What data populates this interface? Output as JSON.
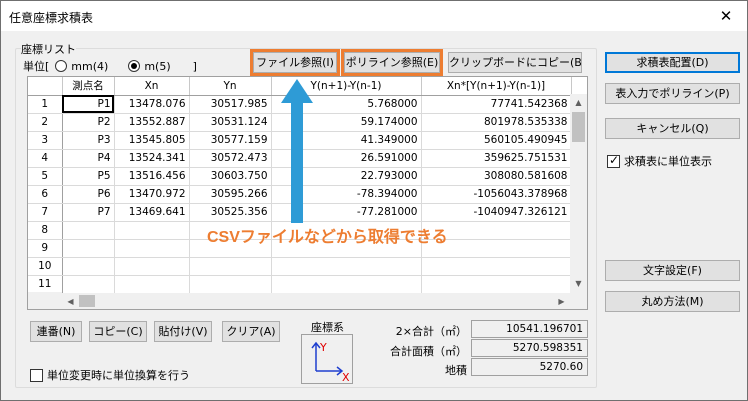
{
  "window": {
    "title": "任意座標求積表",
    "close_symbol": "✕"
  },
  "coord_list": {
    "group_label": "座標リスト",
    "unit_prefix": "単位[",
    "unit_options": [
      {
        "label": "mm(4)",
        "selected": false
      },
      {
        "label": "m(5)",
        "selected": true
      }
    ],
    "unit_suffix": "]",
    "file_button": "ファイル参照(I)",
    "polyline_button": "ポリライン参照(E)",
    "clipboard_button": "クリップボードにコピー(B)"
  },
  "table": {
    "headers": [
      "測点名",
      "Xn",
      "Yn",
      "Y(n+1)-Y(n-1)",
      "Xn*[Y(n+1)-Y(n-1)]"
    ],
    "rows": [
      {
        "no": "1",
        "name": "P1",
        "xn": "13478.076",
        "yn": "30517.985",
        "dy": "5.768000",
        "prod": "77741.542368"
      },
      {
        "no": "2",
        "name": "P2",
        "xn": "13552.887",
        "yn": "30531.124",
        "dy": "59.174000",
        "prod": "801978.535338"
      },
      {
        "no": "3",
        "name": "P3",
        "xn": "13545.805",
        "yn": "30577.159",
        "dy": "41.349000",
        "prod": "560105.490945"
      },
      {
        "no": "4",
        "name": "P4",
        "xn": "13524.341",
        "yn": "30572.473",
        "dy": "26.591000",
        "prod": "359625.751531"
      },
      {
        "no": "5",
        "name": "P5",
        "xn": "13516.456",
        "yn": "30603.750",
        "dy": "22.793000",
        "prod": "308080.581608"
      },
      {
        "no": "6",
        "name": "P6",
        "xn": "13470.972",
        "yn": "30595.266",
        "dy": "-78.394000",
        "prod": "-1056043.378968"
      },
      {
        "no": "7",
        "name": "P7",
        "xn": "13469.641",
        "yn": "30525.356",
        "dy": "-77.281000",
        "prod": "-1040947.326121"
      },
      {
        "no": "8",
        "name": "",
        "xn": "",
        "yn": "",
        "dy": "",
        "prod": ""
      },
      {
        "no": "9",
        "name": "",
        "xn": "",
        "yn": "",
        "dy": "",
        "prod": ""
      },
      {
        "no": "10",
        "name": "",
        "xn": "",
        "yn": "",
        "dy": "",
        "prod": ""
      },
      {
        "no": "11",
        "name": "",
        "xn": "",
        "yn": "",
        "dy": "",
        "prod": ""
      }
    ]
  },
  "annotation": {
    "text": "CSVファイルなどから取得できる",
    "color": "#ed7d31"
  },
  "bottom_buttons": {
    "sequence": "連番(N)",
    "copy": "コピー(C)",
    "paste": "貼付け(V)",
    "clear": "クリア(A)"
  },
  "coord_system": {
    "label": "座標系",
    "axis_y": "Y",
    "axis_x": "X"
  },
  "sums": {
    "double_total_label": "2×合計（㎡）",
    "double_total_value": "10541.196701",
    "total_area_label": "合計面積（㎡）",
    "total_area_value": "5270.598351",
    "land_area_label": "地積",
    "land_area_value": "5270.60"
  },
  "unit_convert_checkbox": {
    "label": "単位変更時に単位換算を行う",
    "checked": false
  },
  "right_panel": {
    "place_button": "求積表配置(D)",
    "table_polyline_button": "表入力でポリライン(P)",
    "cancel_button": "キャンセル(Q)",
    "show_unit_checkbox": {
      "label": "求積表に単位表示",
      "checked": true
    },
    "font_button": "文字設定(F)",
    "rounding_button": "丸め方法(M)"
  }
}
